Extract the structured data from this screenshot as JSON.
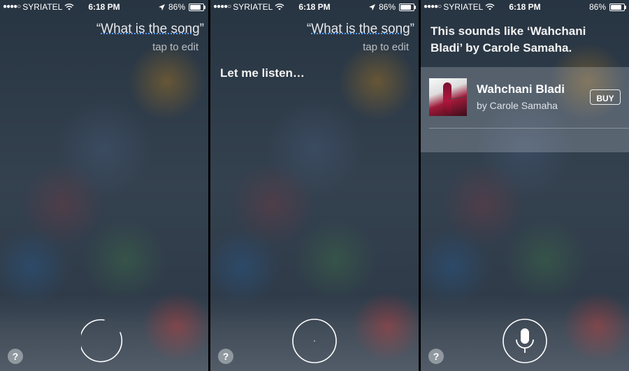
{
  "status_bar": {
    "signal_dots": "●●●●○",
    "carrier": "SYRIATEL",
    "time": "6:18 PM",
    "battery": "86%"
  },
  "screens": [
    {
      "query": {
        "open_quote": "“",
        "text": "What is the song",
        "close_quote": "”"
      },
      "tap_to_edit": "tap to edit"
    },
    {
      "query": {
        "open_quote": "“",
        "text": "What is the song",
        "close_quote": "”"
      },
      "tap_to_edit": "tap to edit",
      "response": "Let me listen…"
    },
    {
      "response": "This sounds like ‘Wahchani Bladi’ by Carole Samaha.",
      "song": {
        "title": "Wahchani Bladi",
        "artist": "by Carole Samaha",
        "buy_label": "BUY"
      }
    }
  ],
  "help_label": "?",
  "icons": {
    "wifi": "wifi-icon",
    "location": "location-arrow-icon",
    "battery": "battery-icon",
    "help": "help-icon",
    "microphone": "microphone-icon",
    "spinner": "siri-spinner-icon",
    "listening": "siri-listening-ring-icon"
  },
  "colors": {
    "underline_accent": "#5aa0ff",
    "text": "#ffffff"
  }
}
